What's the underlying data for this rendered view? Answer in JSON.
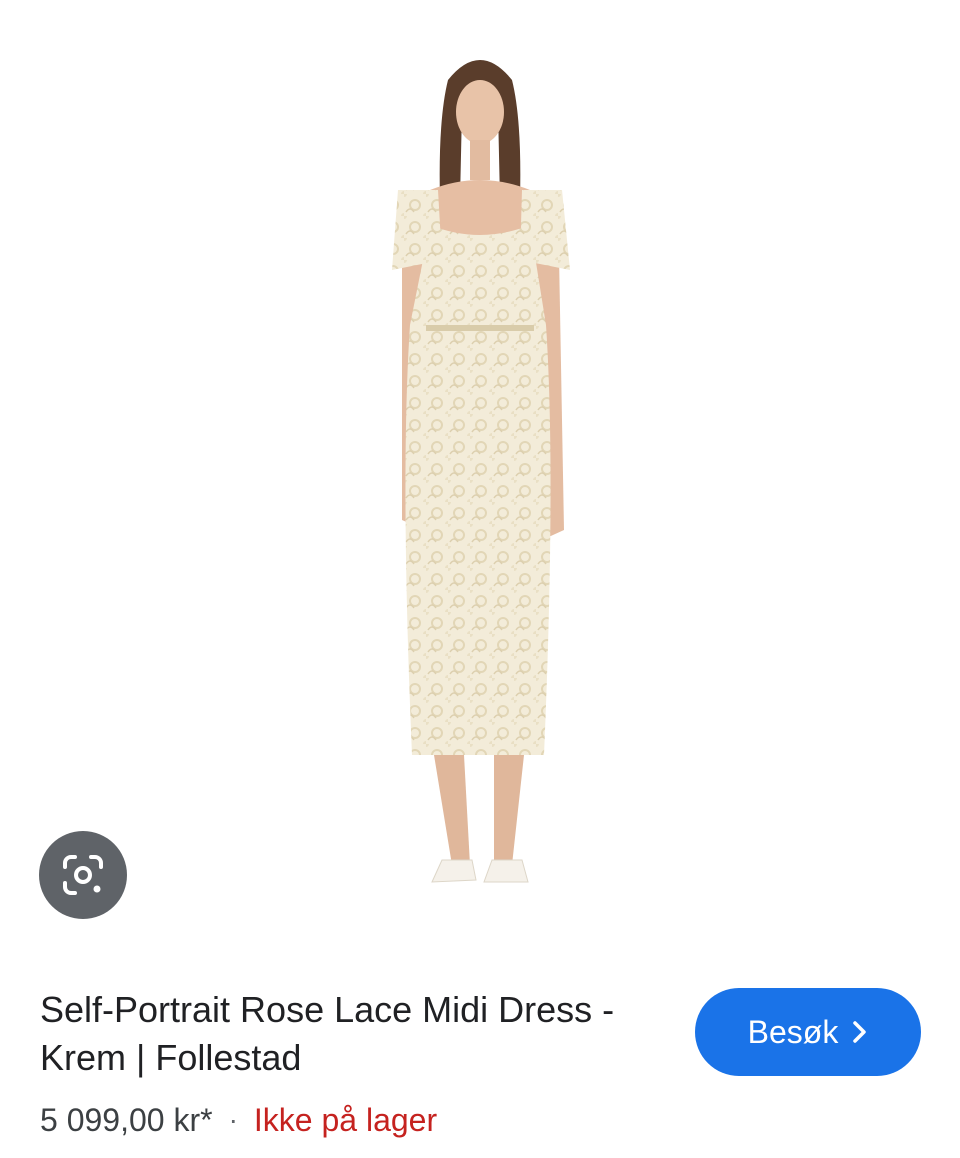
{
  "product": {
    "title": "Self-Portrait Rose Lace Midi Dress - Krem | Follestad",
    "price": "5 099,00 kr*",
    "separator": "·",
    "stock_status": "Ikke på lager"
  },
  "actions": {
    "visit_label": "Besøk",
    "visit_icon": "chevron-right-icon",
    "lens_icon": "google-lens-icon"
  },
  "colors": {
    "visit_button_bg": "#1a73e8",
    "stock_status": "#c5221f",
    "lens_button_bg": "#5f6368"
  }
}
